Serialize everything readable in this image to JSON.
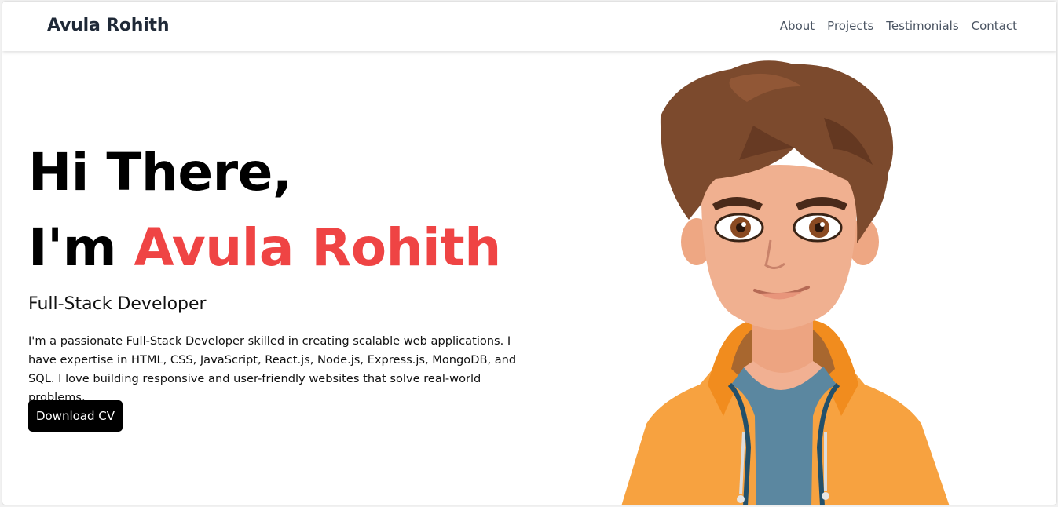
{
  "navbar": {
    "brand": "Avula Rohith",
    "links": [
      "About",
      "Projects",
      "Testimonials",
      "Contact"
    ]
  },
  "hero": {
    "greeting": "Hi There,",
    "intro_prefix": "I'm",
    "name": "Avula Rohith",
    "role": "Full-Stack Developer",
    "bio": "I'm a passionate Full-Stack Developer skilled in creating scalable web applications. I have expertise in HTML, CSS, JavaScript, React.js, Node.js, Express.js, MongoDB, and SQL. I love building responsive and user-friendly websites that solve real-world problems.",
    "cta_label": "Download CV"
  },
  "colors": {
    "accent": "#ef4444",
    "button_bg": "#000000",
    "hoodie": "#f7a240",
    "shirt": "#5b87a0",
    "hair": "#7c4a2d",
    "skin": "#f0b090"
  }
}
